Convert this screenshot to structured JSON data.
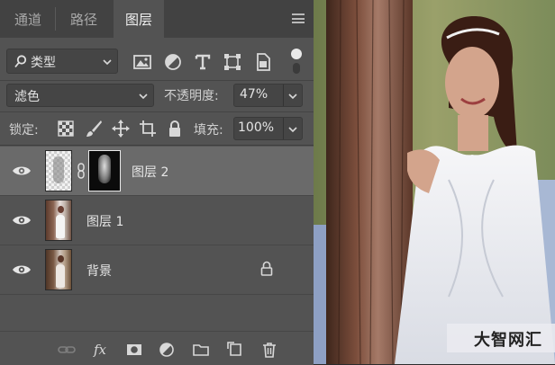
{
  "tabs": [
    {
      "label": "通道",
      "active": false
    },
    {
      "label": "路径",
      "active": false
    },
    {
      "label": "图层",
      "active": true
    }
  ],
  "filter": {
    "kind_label": "类型",
    "toggle_state": "on"
  },
  "blend": {
    "mode": "滤色",
    "opacity_label": "不透明度:",
    "opacity_value": "47%"
  },
  "lock": {
    "label": "锁定:",
    "fill_label": "填充:",
    "fill_value": "100%"
  },
  "layers": [
    {
      "name": "图层 2",
      "selected": true,
      "visible": true,
      "has_mask": true,
      "locked": false
    },
    {
      "name": "图层 1",
      "selected": false,
      "visible": true,
      "has_mask": false,
      "locked": false
    },
    {
      "name": "背景",
      "selected": false,
      "visible": true,
      "has_mask": false,
      "locked": true
    }
  ],
  "bottom_icons": [
    "link-layers-icon",
    "fx-icon",
    "add-mask-icon",
    "adjustment-layer-icon",
    "new-group-icon",
    "new-layer-icon",
    "delete-layer-icon"
  ],
  "watermark": {
    "text": "大智网汇"
  },
  "colors": {
    "panel": "#535353",
    "tabbar": "#424242",
    "selected_row": "#6a6a6a"
  }
}
